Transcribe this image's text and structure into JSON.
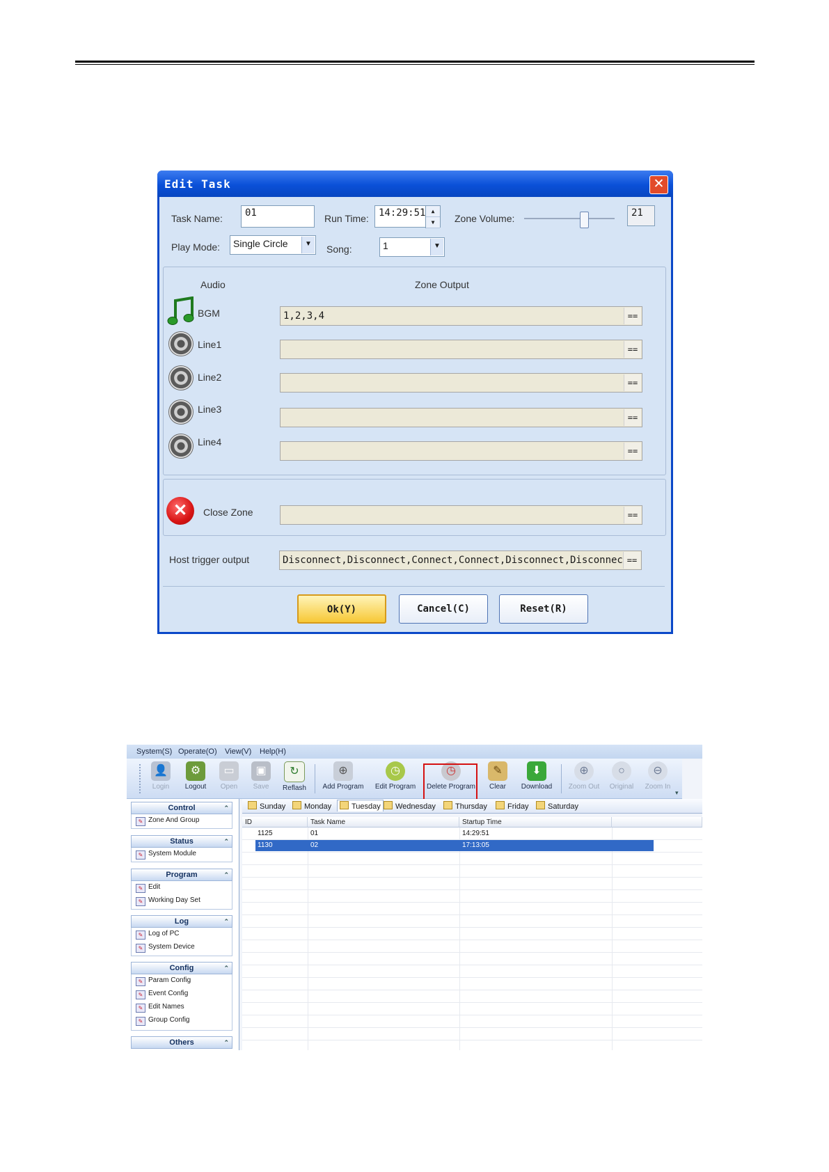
{
  "dialog": {
    "title": "Edit Task",
    "close": "✕",
    "task_name_label": "Task Name:",
    "task_name_value": "01",
    "run_time_label": "Run Time:",
    "run_time_value": "14:29:51",
    "zone_volume_label": "Zone Volume:",
    "zone_volume_value": "21",
    "play_mode_label": "Play Mode:",
    "play_mode_value": "Single Circle",
    "song_label": "Song:",
    "song_value": "1",
    "audio_header": "Audio",
    "zone_output_header": "Zone Output",
    "sources": [
      {
        "label": "BGM",
        "output": "1,2,3,4"
      },
      {
        "label": "Line1",
        "output": ""
      },
      {
        "label": "Line2",
        "output": ""
      },
      {
        "label": "Line3",
        "output": ""
      },
      {
        "label": "Line4",
        "output": ""
      }
    ],
    "close_zone_label": "Close Zone",
    "close_zone_output": "",
    "host_trigger_label": "Host trigger output",
    "host_trigger_value": "Disconnect,Disconnect,Connect,Connect,Disconnect,Disconnect,Connect,C",
    "picker": "==",
    "ok": "Ok(Y)",
    "cancel": "Cancel(C)",
    "reset": "Reset(R)"
  },
  "app": {
    "menu": [
      "System(S)",
      "Operate(O)",
      "View(V)",
      "Help(H)"
    ],
    "toolbar": [
      {
        "label": "Login",
        "icon": "login-icon",
        "enabled": false
      },
      {
        "label": "Logout",
        "icon": "logout-icon",
        "enabled": true
      },
      {
        "label": "Open",
        "icon": "open-icon",
        "enabled": false
      },
      {
        "label": "Save",
        "icon": "save-icon",
        "enabled": false
      },
      {
        "label": "Reflash",
        "icon": "refresh-icon",
        "enabled": true
      },
      {
        "label": "Add Program",
        "icon": "add-program-icon",
        "enabled": true
      },
      {
        "label": "Edit Program",
        "icon": "edit-program-icon",
        "enabled": true
      },
      {
        "label": "Delete Program",
        "icon": "delete-program-icon",
        "enabled": true,
        "highlighted": true
      },
      {
        "label": "Clear",
        "icon": "clear-icon",
        "enabled": true
      },
      {
        "label": "Download",
        "icon": "download-icon",
        "enabled": true
      },
      {
        "label": "Zoom Out",
        "icon": "zoom-out-icon",
        "enabled": false
      },
      {
        "label": "Original",
        "icon": "original-icon",
        "enabled": false
      },
      {
        "label": "Zoom In",
        "icon": "zoom-in-icon",
        "enabled": false
      }
    ],
    "sidebar": [
      {
        "title": "Control",
        "items": [
          "Zone And Group"
        ]
      },
      {
        "title": "Status",
        "items": [
          "System Module"
        ]
      },
      {
        "title": "Program",
        "items": [
          "Edit",
          "Working Day Set"
        ]
      },
      {
        "title": "Log",
        "items": [
          "Log of PC",
          "System Device"
        ]
      },
      {
        "title": "Config",
        "items": [
          "Param Config",
          "Event Config",
          "Edit Names",
          "Group Config"
        ]
      },
      {
        "title": "Others",
        "items": []
      }
    ],
    "days": [
      "Sunday",
      "Monday",
      "Tuesday",
      "Wednesday",
      "Thursday",
      "Friday",
      "Saturday"
    ],
    "selected_day": "Tuesday",
    "columns": [
      "ID",
      "Task Name",
      "Startup Time"
    ],
    "rows": [
      {
        "id": "1125",
        "task_name": "01",
        "startup_time": "14:29:51",
        "selected": false
      },
      {
        "id": "1130",
        "task_name": "02",
        "startup_time": "17:13:05",
        "selected": true
      }
    ],
    "colors": {
      "selection": "#3169c6",
      "highlight_box": "#d51111",
      "dialog_frame": "#0a48c8"
    }
  }
}
